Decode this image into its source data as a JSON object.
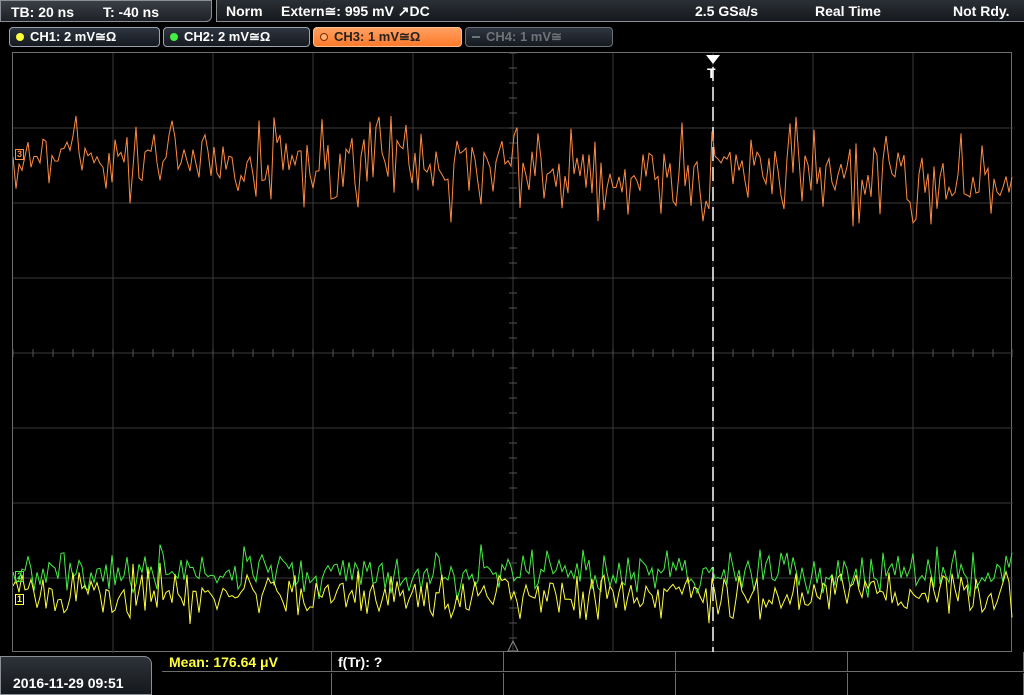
{
  "timebase": {
    "tb": "TB: 20 ns",
    "t": "T: -40 ns"
  },
  "status": {
    "mode": "Norm",
    "trigger": "Extern≅: 995 mV ↗DC",
    "sample_rate": "2.5 GSa/s",
    "acq": "Real Time",
    "state": "Not Rdy."
  },
  "channels": [
    {
      "label": "CH1: 2 mV≅Ω",
      "color": "#ffff3a"
    },
    {
      "label": "CH2: 2 mV≅Ω",
      "color": "#44ee44"
    },
    {
      "label": "CH3: 1 mV≅Ω",
      "color": "#ff8c40"
    },
    {
      "label": "CH4: 1 mV≅",
      "color": "#6e7378"
    }
  ],
  "trigger_marker": "T",
  "markers": {
    "ch1": "1",
    "ch2": "2",
    "ch3": "3"
  },
  "datetime": "2016-11-29 09:51",
  "measurements": {
    "mean": "Mean: 176.64 μV",
    "ftr": "f(Tr): ?"
  }
}
